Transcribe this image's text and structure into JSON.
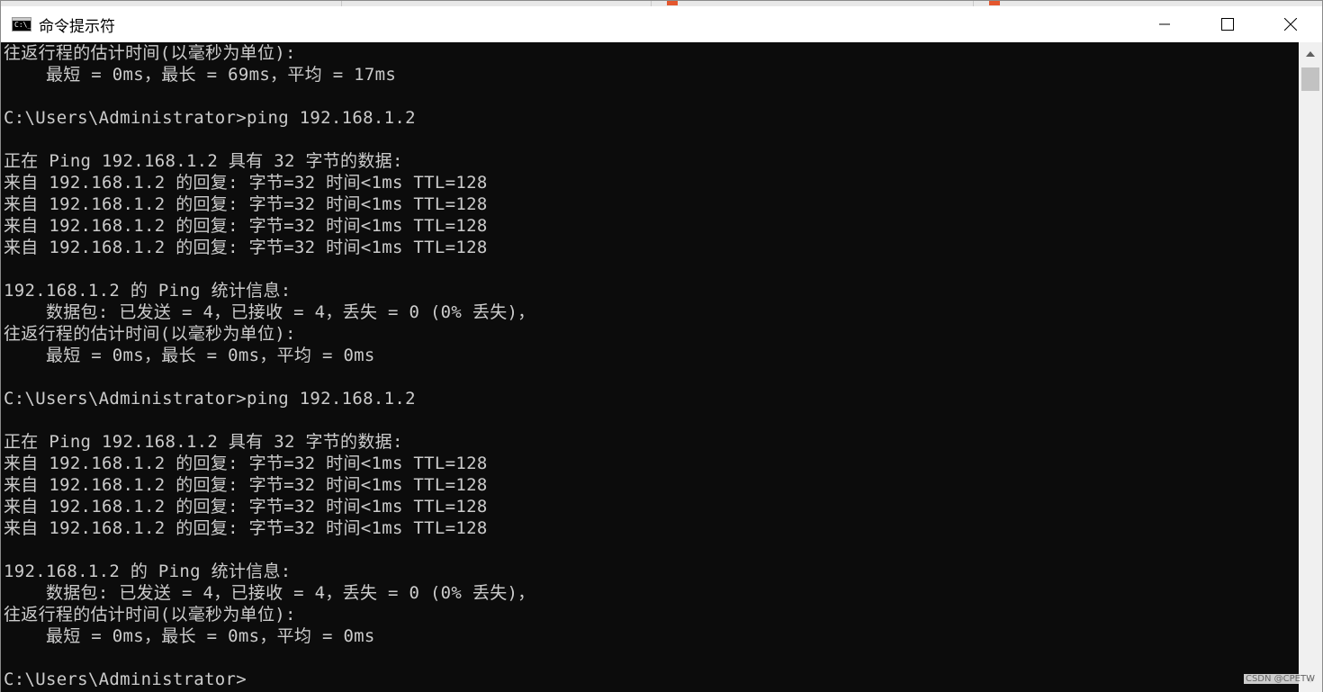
{
  "window": {
    "title": "命令提示符",
    "icon": "cmd-icon",
    "icon_glyph": "C:\\_",
    "controls": [
      "minimize-icon",
      "maximize-icon",
      "close-icon"
    ]
  },
  "console": {
    "lines": [
      "往返行程的估计时间(以毫秒为单位):",
      "    最短 = 0ms，最长 = 69ms，平均 = 17ms",
      "",
      "C:\\Users\\Administrator>ping 192.168.1.2",
      "",
      "正在 Ping 192.168.1.2 具有 32 字节的数据:",
      "来自 192.168.1.2 的回复: 字节=32 时间<1ms TTL=128",
      "来自 192.168.1.2 的回复: 字节=32 时间<1ms TTL=128",
      "来自 192.168.1.2 的回复: 字节=32 时间<1ms TTL=128",
      "来自 192.168.1.2 的回复: 字节=32 时间<1ms TTL=128",
      "",
      "192.168.1.2 的 Ping 统计信息:",
      "    数据包: 已发送 = 4，已接收 = 4，丢失 = 0 (0% 丢失)，",
      "往返行程的估计时间(以毫秒为单位):",
      "    最短 = 0ms，最长 = 0ms，平均 = 0ms",
      "",
      "C:\\Users\\Administrator>ping 192.168.1.2",
      "",
      "正在 Ping 192.168.1.2 具有 32 字节的数据:",
      "来自 192.168.1.2 的回复: 字节=32 时间<1ms TTL=128",
      "来自 192.168.1.2 的回复: 字节=32 时间<1ms TTL=128",
      "来自 192.168.1.2 的回复: 字节=32 时间<1ms TTL=128",
      "来自 192.168.1.2 的回复: 字节=32 时间<1ms TTL=128",
      "",
      "192.168.1.2 的 Ping 统计信息:",
      "    数据包: 已发送 = 4，已接收 = 4，丢失 = 0 (0% 丢失)，",
      "往返行程的估计时间(以毫秒为单位):",
      "    最短 = 0ms，最长 = 0ms，平均 = 0ms",
      "",
      "C:\\Users\\Administrator>"
    ]
  },
  "colors": {
    "console_background": "#0c0c0c",
    "console_text": "#cccccc",
    "titlebar_background": "#ffffff",
    "scrollbar_track": "#f0f0f0",
    "scrollbar_thumb": "#c2c2c2"
  },
  "watermark": "CSDN @CPETW"
}
